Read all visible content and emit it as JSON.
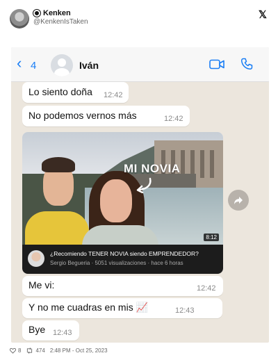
{
  "tweet": {
    "author_name": "Kenken",
    "handle": "@KenkenIsTaken",
    "likes": "8",
    "retweets": "474",
    "timestamp": "2:48 PM - Oct 25, 2023"
  },
  "chat": {
    "back_count": "4",
    "contact_name": "Iván",
    "messages": [
      {
        "text": "Lo siento doña",
        "time": "12:42"
      },
      {
        "text": "No podemos vernos más",
        "time": "12:42"
      },
      {
        "text": "Me vi:",
        "time": "12:42"
      },
      {
        "text": "Y no me cuadras en mis 📈",
        "time": "12:43"
      },
      {
        "text": "Bye",
        "time": "12:43"
      }
    ],
    "video": {
      "overlay_text": "MI NOVIA",
      "duration": "8:12",
      "title": "¿Recomiendo TENER NOVIA siendo EMPRENDEDOR?",
      "meta": "Sergio Begueria · 5051 visualizaciones · hace 6 horas"
    }
  },
  "icons": {
    "verified": "verified-badge-icon",
    "x_logo": "x-logo-icon",
    "back": "chevron-left-icon",
    "video_call": "video-camera-icon",
    "call": "phone-icon",
    "share": "forward-icon",
    "like": "heart-icon",
    "retweet": "retweet-icon"
  },
  "colors": {
    "accent": "#1a7ef5",
    "chat_background": "#ece6dd",
    "bubble": "#ffffff"
  }
}
